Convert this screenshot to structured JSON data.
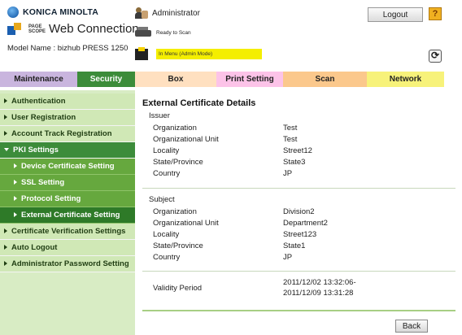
{
  "header": {
    "brand": "KONICA MINOLTA",
    "pagescope_small": "PAGE SCOPE",
    "app_title": "Web Connection",
    "model": "Model Name : bizhub PRESS 1250",
    "user": "Administrator",
    "logout_label": "Logout",
    "help_label": "?",
    "status_ready": "Ready to Scan",
    "status_menu": "In Menu (Admin Mode)",
    "refresh_label": "⟳"
  },
  "tabs": [
    "Maintenance",
    "Security",
    "Box",
    "Print Setting",
    "Scan",
    "Network"
  ],
  "sidebar": {
    "items": [
      {
        "label": "Authentication"
      },
      {
        "label": "User Registration"
      },
      {
        "label": "Account Track Registration"
      },
      {
        "label": "PKI Settings"
      },
      {
        "label": "Device Certificate Setting"
      },
      {
        "label": "SSL Setting"
      },
      {
        "label": "Protocol Setting"
      },
      {
        "label": "External Certificate Setting"
      },
      {
        "label": "Certificate Verification Settings"
      },
      {
        "label": "Auto Logout"
      },
      {
        "label": "Administrator Password Setting"
      }
    ]
  },
  "main": {
    "title": "External Certificate Details",
    "issuer": {
      "heading": "Issuer",
      "rows": [
        {
          "label": "Organization",
          "value": "Test"
        },
        {
          "label": "Organizational Unit",
          "value": "Test"
        },
        {
          "label": "Locality",
          "value": "Street12"
        },
        {
          "label": "State/Province",
          "value": "State3"
        },
        {
          "label": "Country",
          "value": "JP"
        }
      ]
    },
    "subject": {
      "heading": "Subject",
      "rows": [
        {
          "label": "Organization",
          "value": "Division2"
        },
        {
          "label": "Organizational Unit",
          "value": "Department2"
        },
        {
          "label": "Locality",
          "value": "Street123"
        },
        {
          "label": "State/Province",
          "value": "State1"
        },
        {
          "label": "Country",
          "value": "JP"
        }
      ]
    },
    "validity": {
      "label": "Validity Period",
      "from": "2011/12/02 13:32:06-",
      "to": "2011/12/09 13:31:28"
    },
    "back_label": "Back"
  }
}
